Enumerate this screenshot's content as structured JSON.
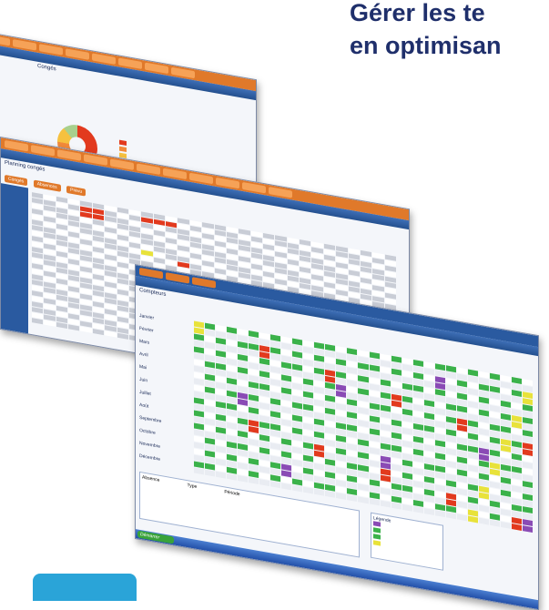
{
  "headline": {
    "line1": "Gérer les te",
    "line2": "en optimisan"
  },
  "colors": {
    "headline": "#1f2f6b",
    "orange": "#e0792a",
    "blue": "#2a5aa0",
    "green": "#3bb24a",
    "red": "#e23a1e",
    "yellow": "#e8e23a",
    "purple": "#8a4bb5"
  },
  "back_window": {
    "panel_title": "Congés"
  },
  "middle_window": {
    "title": "Planning congés",
    "tabs": [
      "Congés",
      "Absences",
      "Prévu"
    ]
  },
  "front_window": {
    "title": "Compteurs",
    "start_label": "Démarrer",
    "months": [
      "Janvier",
      "Février",
      "Mars",
      "Avril",
      "Mai",
      "Juin",
      "Juillet",
      "Août",
      "Septembre",
      "Octobre",
      "Novembre",
      "Décembre"
    ],
    "legend_title": "Légende",
    "table_header": [
      "Absence",
      "Type",
      "Période"
    ]
  }
}
